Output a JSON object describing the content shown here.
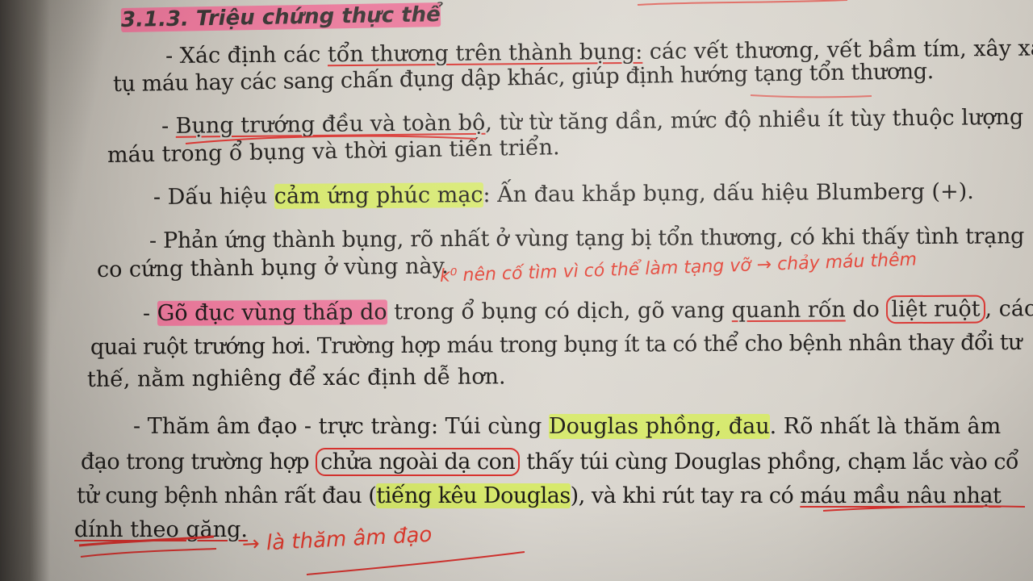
{
  "heading": "3.1.3. Triệu chứng thực thể",
  "paragraphs": {
    "p1": {
      "line1": {
        "a": "- Xác định các ",
        "b": "tổn thương trên thành bụng:",
        "c": " các vết thương, vết bầm tím, xây xát,"
      },
      "line2": "tụ máu hay các sang chấn đụng dập khác, giúp định hướng tạng tổn thương."
    },
    "p2": {
      "line1": {
        "a": "- ",
        "b": "Bụng trướng đều và toàn bộ",
        "c": ", từ từ tăng dần, mức độ nhiều ít tùy thuộc lượng"
      },
      "line2": "máu trong ổ bụng và thời gian tiến triển."
    },
    "p3": {
      "line1": {
        "a": "- Dấu hiệu ",
        "b": "cảm ứng phúc mạc",
        "c": ": Ấn đau khắp bụng, dấu hiệu Blumberg (+)."
      }
    },
    "p4": {
      "line1": "- Phản ứng thành bụng, rõ nhất ở vùng tạng bị tổn thương, có khi thấy tình trạng",
      "line2": "co cứng thành bụng ở vùng này."
    },
    "p5": {
      "line1": {
        "a": "- ",
        "b": "Gõ đục vùng thấp do",
        "c": " trong ổ bụng có dịch, gõ vang ",
        "d": "quanh rốn",
        "e": " do ",
        "f": "liệt ruột",
        "g": ", các"
      },
      "line2": "quai ruột trướng hơi. Trường hợp máu trong bụng ít ta có thể cho bệnh nhân thay đổi tư",
      "line3": "thế, nằm nghiêng để xác định dễ hơn."
    },
    "p6": {
      "line1": {
        "a": "- Thăm âm đạo - trực tràng: Túi cùng ",
        "b": "Douglas phồng, đau",
        "c": ". Rõ nhất là thăm âm"
      },
      "line2": {
        "a": "đạo trong trường hợp ",
        "b": "chửa ngoài dạ con",
        "c": " thấy túi cùng Douglas phồng, chạm lắc vào cổ"
      },
      "line3": {
        "a": "tử cung bệnh nhân rất đau (",
        "b": "tiếng kêu Douglas",
        "c": "), và khi rút tay ra có ",
        "d": "máu mầu nâu nhạt"
      },
      "line4": "dính theo găng."
    }
  },
  "handwritten_notes": {
    "note_1": "k⁰ nên cố tìm vì có thể làm tạng vỡ → chảy máu thêm",
    "note_2": "→ là thăm âm đạo"
  },
  "colors": {
    "ink": "#1d1a18",
    "pen_red": "#d8322e",
    "highlighter_pink": "#f25a8c",
    "highlighter_yellow": "#d6f046"
  }
}
